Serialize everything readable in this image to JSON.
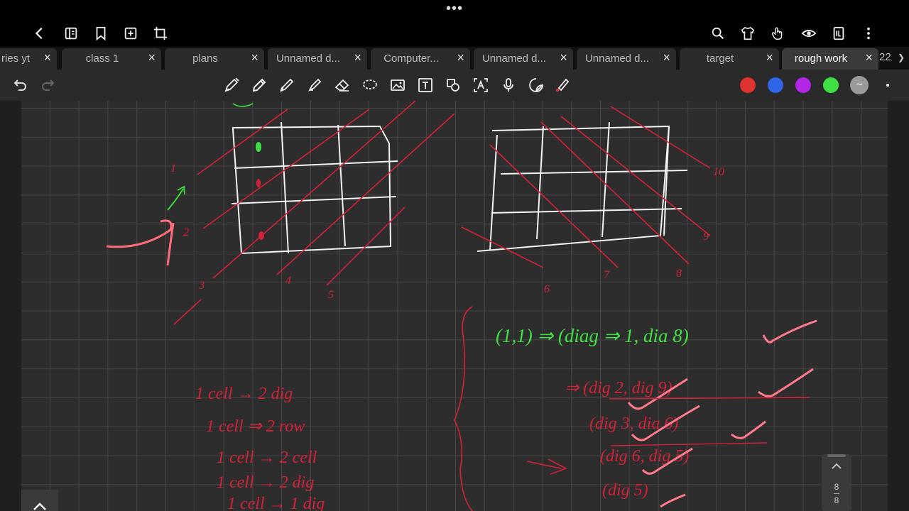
{
  "tabs": [
    {
      "label": "ries yt"
    },
    {
      "label": "class 1"
    },
    {
      "label": "plans"
    },
    {
      "label": "Unnamed d..."
    },
    {
      "label": "Computer..."
    },
    {
      "label": "Unnamed d..."
    },
    {
      "label": "Unnamed d..."
    },
    {
      "label": "target"
    },
    {
      "label": "rough work"
    }
  ],
  "tab_count": "22",
  "colors": {
    "red": "#e0322e",
    "blue": "#2f66e8",
    "purple": "#b325e8",
    "green": "#3ee043",
    "gray": "#9a9a9a"
  },
  "page_indicator": {
    "current": "8",
    "total": "8"
  },
  "canvas": {
    "grid_labels_left": [
      "1",
      "2",
      "3",
      "4",
      "5"
    ],
    "grid_labels_right": [
      "10",
      "9",
      "8",
      "7",
      "6"
    ],
    "green_note": "(1,1) ⇒ (diag ⇒ 1, dia 8)",
    "red_notes_left": [
      "1 cell → 2 dig",
      "1 cell ⇒ 2 row",
      "1 cell → 2 cell",
      "1 cell → 2 dig",
      "1 cell → 1 dig"
    ],
    "red_notes_right": [
      "⇒ (dig 2, dig 9)",
      "(dig 3, dia 6)",
      "(dig 6, dig 5)",
      "(dig 5)"
    ]
  }
}
